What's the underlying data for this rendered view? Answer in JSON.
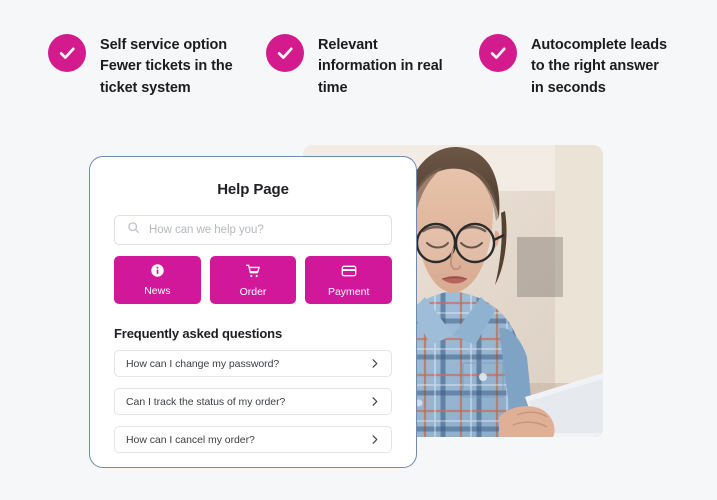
{
  "page": {
    "background_color": "#f6f7f9",
    "accent_color": "#d2189a",
    "card_border_color": "#6e8ab0"
  },
  "benefits": [
    {
      "icon": "check-circle-icon",
      "line1": "Self service option",
      "line2": "Fewer tickets in the",
      "line3": "ticket system"
    },
    {
      "icon": "check-circle-icon",
      "line1": "Relevant",
      "line2": "information in real",
      "line3": "time"
    },
    {
      "icon": "check-circle-icon",
      "line1": "Autocomplete leads",
      "line2": "to the right answer",
      "line3": "in seconds"
    }
  ],
  "help_card": {
    "title": "Help Page",
    "search": {
      "icon": "search-icon",
      "placeholder": "How can we help you?",
      "value": ""
    },
    "quick_actions": [
      {
        "label": "News",
        "icon": "info-icon"
      },
      {
        "label": "Order",
        "icon": "shopping-cart-icon"
      },
      {
        "label": "Payment",
        "icon": "credit-card-icon"
      }
    ],
    "faq_heading": "Frequently asked questions",
    "faq_items": [
      {
        "question": "How can I change my password?",
        "icon": "chevron-right-icon"
      },
      {
        "question": "Can I track the status of my order?",
        "icon": "chevron-right-icon"
      },
      {
        "question": "How can I cancel my order?",
        "icon": "chevron-right-icon"
      }
    ]
  },
  "photo": {
    "alt": "Woman with glasses in plaid shirt looking at a smartphone"
  }
}
